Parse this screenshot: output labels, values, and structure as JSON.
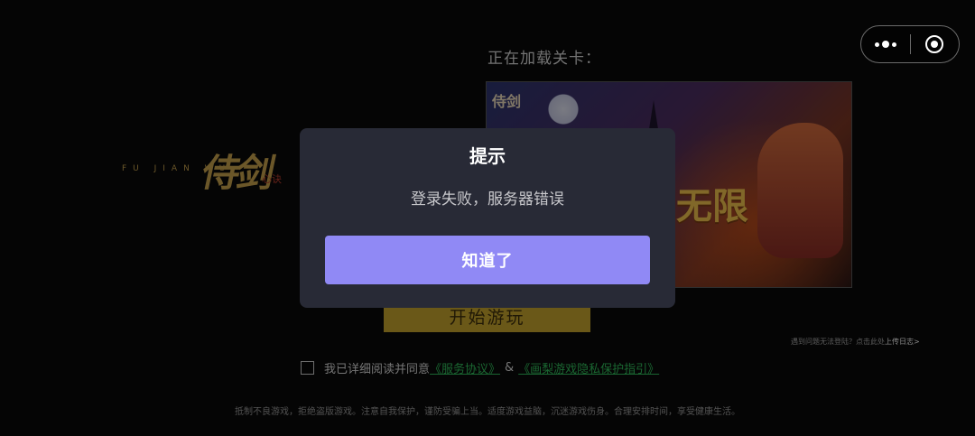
{
  "background": {
    "logo": {
      "calligraphy": "侍剑",
      "subtitle": "FU JIAN WU",
      "red_mark": "心诀"
    },
    "loading_label": "正在加载关卡：",
    "banner": {
      "corner_mark": "侍剑",
      "title": "无限"
    },
    "start_button_label": "开始游玩",
    "upload_log": {
      "prefix": "遇到问题无法登陆？点击此处",
      "link": "上传日志>"
    },
    "agreement": {
      "text": "我已详细阅读并同意",
      "service_link": "《服务协议》",
      "ampersand": "&",
      "privacy_link": "《画梨游戏隐私保护指引》"
    },
    "footer_notice": "抵制不良游戏，拒绝盗版游戏。注意自我保护，谨防受骗上当。适度游戏益脑，沉迷游戏伤身。合理安排时间，享受健康生活。"
  },
  "capsule": {
    "more_icon": "more-dots-icon",
    "close_icon": "exit-miniprogram-icon"
  },
  "dialog": {
    "title": "提示",
    "message": "登录失败，服务器错误",
    "confirm_label": "知道了",
    "accent_color": "#9089f5"
  }
}
